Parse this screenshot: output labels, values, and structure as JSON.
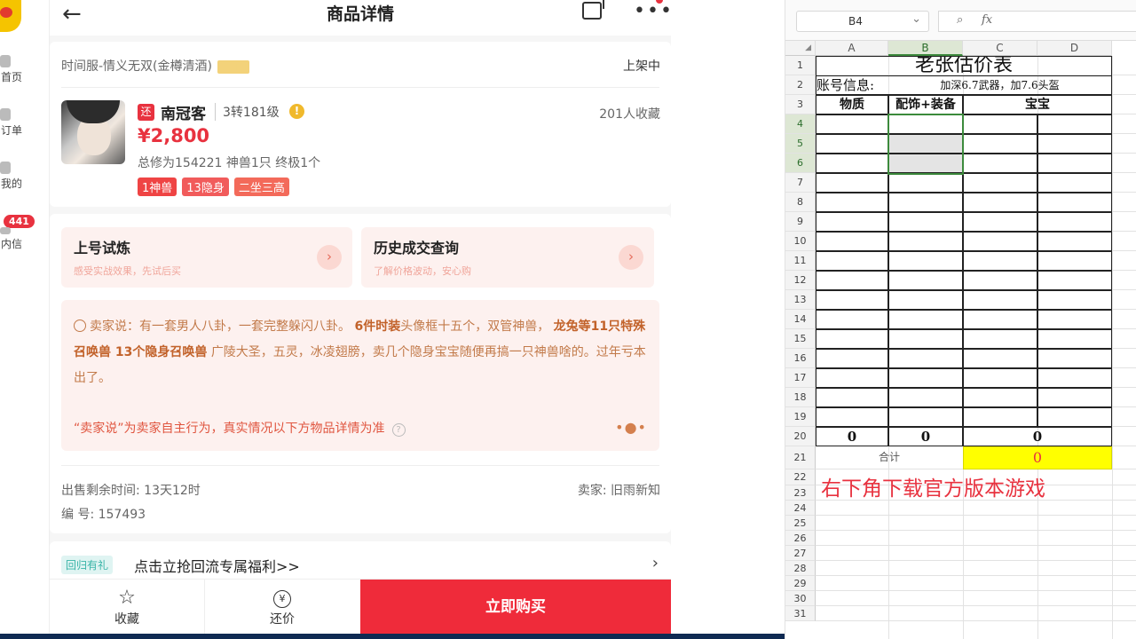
{
  "app": {
    "title": "商品详情",
    "back_icon": "←",
    "more_icon": "•••",
    "nav": [
      {
        "label": "首页"
      },
      {
        "label": "订单"
      },
      {
        "label": "我的"
      },
      {
        "label": "内信"
      }
    ],
    "nav_badge": "441",
    "listing": {
      "server": "时间服-情义无双(金樽清酒)",
      "status": "上架中",
      "huan_badge": "还",
      "role_name": "南冠客",
      "role_level": "3转181级",
      "info_glyph": "!",
      "favorites": "201人收藏",
      "price": "¥2,800",
      "stats": "总修为154221  神兽1只  终极1个",
      "tags": [
        "1神兽",
        "13隐身",
        "二坐三高"
      ]
    },
    "tiles": [
      {
        "title": "上号试炼",
        "subtitle": "感受实战效果，先试后买"
      },
      {
        "title": "历史成交查询",
        "subtitle": "了解价格波动，安心购"
      }
    ],
    "seller_says": {
      "intro": "卖家说：有一套男人八卦，一套完整躲闪八卦。",
      "bold1": "6件时装",
      "mid1": "头像框十五个，双管神兽，",
      "bold2": "龙兔等11只特殊召唤兽 13个隐身召唤兽",
      "rest": "广陵大圣，五灵，冰凌翅膀，卖几个隐身宝宝随便再搞一只神兽啥的。过年亏本出了。",
      "disclaimer": "“卖家说”为卖家自主行为，真实情况以下方物品详情为准",
      "question_glyph": "?"
    },
    "time_left": "出售剩余时间: 13天12时",
    "seller": "卖家: 旧雨新知",
    "serial": "编 号: 157493",
    "promo": {
      "tag": "回归有礼",
      "text": "点击立抢回流专属福利>>",
      "chevron": "›"
    },
    "bottom": {
      "favorite": "收藏",
      "favorite_icon": "☆",
      "bargain": "还价",
      "bargain_icon": "¥",
      "buy": "立即购买"
    }
  },
  "sheet": {
    "name_box": "B4",
    "fx_label": "fx",
    "columns": [
      "A",
      "B",
      "C",
      "D"
    ],
    "rows": [
      "1",
      "2",
      "3",
      "4",
      "5",
      "6",
      "7",
      "8",
      "9",
      "10",
      "11",
      "12",
      "13",
      "14",
      "15",
      "16",
      "17",
      "18",
      "19",
      "20",
      "21",
      "22",
      "23",
      "24",
      "25",
      "26",
      "27",
      "28",
      "29",
      "30",
      "31"
    ],
    "title": "老张估价表",
    "account_label": "账号信息:",
    "account_value": "加深6.7武器，加7.6头盔",
    "headers": [
      "物质",
      "配饰+装备",
      "宝宝"
    ],
    "row20": [
      "0",
      "0",
      "0"
    ],
    "total_label": "合计",
    "total_value": "0",
    "note": "右下角下载官方版本游戏",
    "colors": {
      "total_fill": "#ffff00",
      "total_text": "#e8323f",
      "note_text": "#e8323f",
      "selection": "#3c8a3c"
    }
  }
}
